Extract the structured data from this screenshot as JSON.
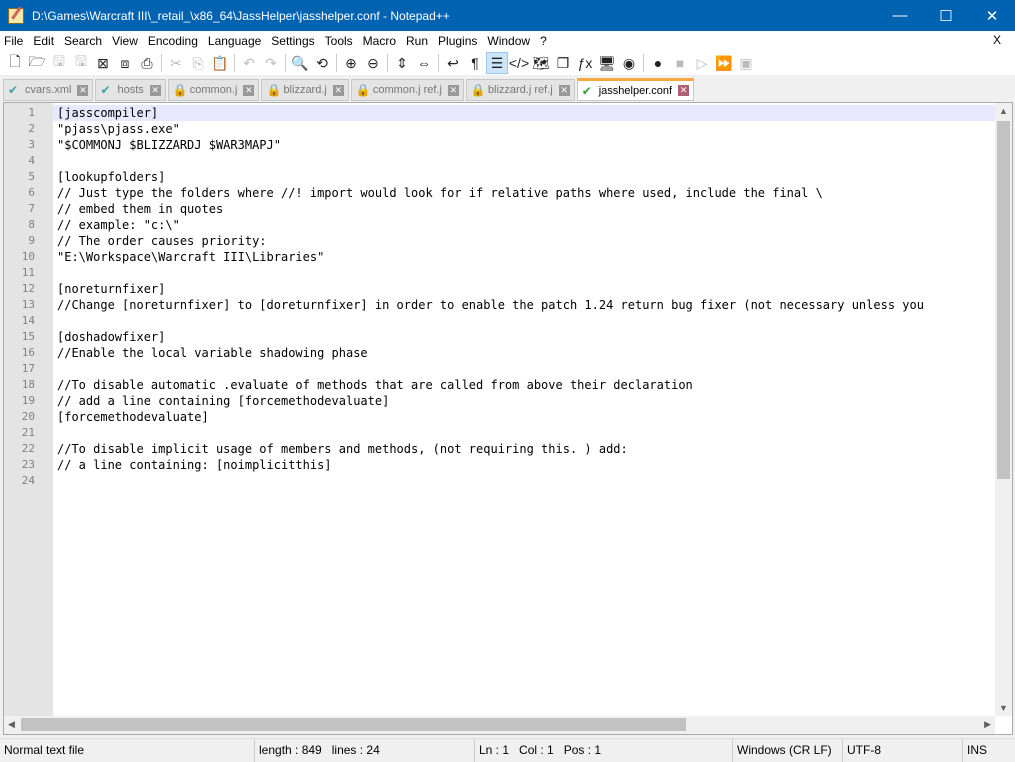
{
  "title": "D:\\Games\\Warcraft III\\_retail_\\x86_64\\JassHelper\\jasshelper.conf - Notepad++",
  "window": {
    "minimize": "—",
    "maximize": "☐",
    "close": "✕"
  },
  "menu": [
    "File",
    "Edit",
    "Search",
    "View",
    "Encoding",
    "Language",
    "Settings",
    "Tools",
    "Macro",
    "Run",
    "Plugins",
    "Window",
    "?"
  ],
  "menu_close": "X",
  "toolbar": [
    {
      "name": "new-file-icon",
      "g": "🗋"
    },
    {
      "name": "open-file-icon",
      "g": "🗁"
    },
    {
      "name": "save-icon",
      "g": "🖫",
      "dis": true
    },
    {
      "name": "save-all-icon",
      "g": "🖫",
      "dis": true
    },
    {
      "name": "close-icon",
      "g": "⊠"
    },
    {
      "name": "close-all-icon",
      "g": "⧈"
    },
    {
      "name": "print-icon",
      "g": "⎙"
    },
    {
      "sep": true
    },
    {
      "name": "cut-icon",
      "g": "✂",
      "dis": true
    },
    {
      "name": "copy-icon",
      "g": "⎘",
      "dis": true
    },
    {
      "name": "paste-icon",
      "g": "📋"
    },
    {
      "sep": true
    },
    {
      "name": "undo-icon",
      "g": "↶",
      "dis": true
    },
    {
      "name": "redo-icon",
      "g": "↷",
      "dis": true
    },
    {
      "sep": true
    },
    {
      "name": "find-icon",
      "g": "🔍"
    },
    {
      "name": "replace-icon",
      "g": "⟲"
    },
    {
      "sep": true
    },
    {
      "name": "zoom-in-icon",
      "g": "⊕"
    },
    {
      "name": "zoom-out-icon",
      "g": "⊖"
    },
    {
      "sep": true
    },
    {
      "name": "sync-vertical-icon",
      "g": "⇕"
    },
    {
      "name": "sync-horizontal-icon",
      "g": "⇔"
    },
    {
      "sep": true
    },
    {
      "name": "word-wrap-icon",
      "g": "↩"
    },
    {
      "name": "show-all-chars-icon",
      "g": "¶"
    },
    {
      "name": "indent-guide-icon",
      "g": "☰",
      "active": true
    },
    {
      "name": "xml-tag-icon",
      "g": "</>"
    },
    {
      "name": "document-map-icon",
      "g": "🗺"
    },
    {
      "name": "document-list-icon",
      "g": "❐"
    },
    {
      "name": "function-list-icon",
      "g": "ƒx"
    },
    {
      "name": "folder-workspace-icon",
      "g": "🖥"
    },
    {
      "name": "monitoring-icon",
      "g": "◉"
    },
    {
      "sep": true
    },
    {
      "name": "record-macro-icon",
      "g": "●"
    },
    {
      "name": "stop-macro-icon",
      "g": "■",
      "dis": true
    },
    {
      "name": "play-macro-icon",
      "g": "▷",
      "dis": true
    },
    {
      "name": "run-macro-multiple-icon",
      "g": "⏩"
    },
    {
      "name": "save-macro-icon",
      "g": "▣",
      "dis": true
    }
  ],
  "tabs": [
    {
      "label": "cvars.xml",
      "icon": "ok"
    },
    {
      "label": "hosts",
      "icon": "ok"
    },
    {
      "label": "common.j",
      "icon": "lock"
    },
    {
      "label": "blizzard.j",
      "icon": "lock"
    },
    {
      "label": "common.j ref.j",
      "icon": "lock"
    },
    {
      "label": "blizzard.j ref.j",
      "icon": "lock"
    },
    {
      "label": "jasshelper.conf",
      "icon": "ok",
      "active": true
    }
  ],
  "lines": [
    "[jasscompiler]",
    "\"pjass\\pjass.exe\"",
    "\"$COMMONJ $BLIZZARDJ $WAR3MAPJ\"",
    "",
    "[lookupfolders]",
    "// Just type the folders where //! import would look for if relative paths where used, include the final \\",
    "// embed them in quotes",
    "// example: \"c:\\\"",
    "// The order causes priority:",
    "\"E:\\Workspace\\Warcraft III\\Libraries\"",
    "",
    "[noreturnfixer]",
    "//Change [noreturnfixer] to [doreturnfixer] in order to enable the patch 1.24 return bug fixer (not necessary unless you",
    "",
    "[doshadowfixer]",
    "//Enable the local variable shadowing phase",
    "",
    "//To disable automatic .evaluate of methods that are called from above their declaration",
    "// add a line containing [forcemethodevaluate]",
    "[forcemethodevaluate]",
    "",
    "//To disable implicit usage of members and methods, (not requiring this. ) add:",
    "// a line containing: [noimplicitthis]",
    ""
  ],
  "status": {
    "type": "Normal text file",
    "length": "length : 849",
    "lines": "lines : 24",
    "ln": "Ln : 1",
    "col": "Col : 1",
    "pos": "Pos : 1",
    "eol": "Windows (CR LF)",
    "encoding": "UTF-8",
    "mode": "INS"
  }
}
